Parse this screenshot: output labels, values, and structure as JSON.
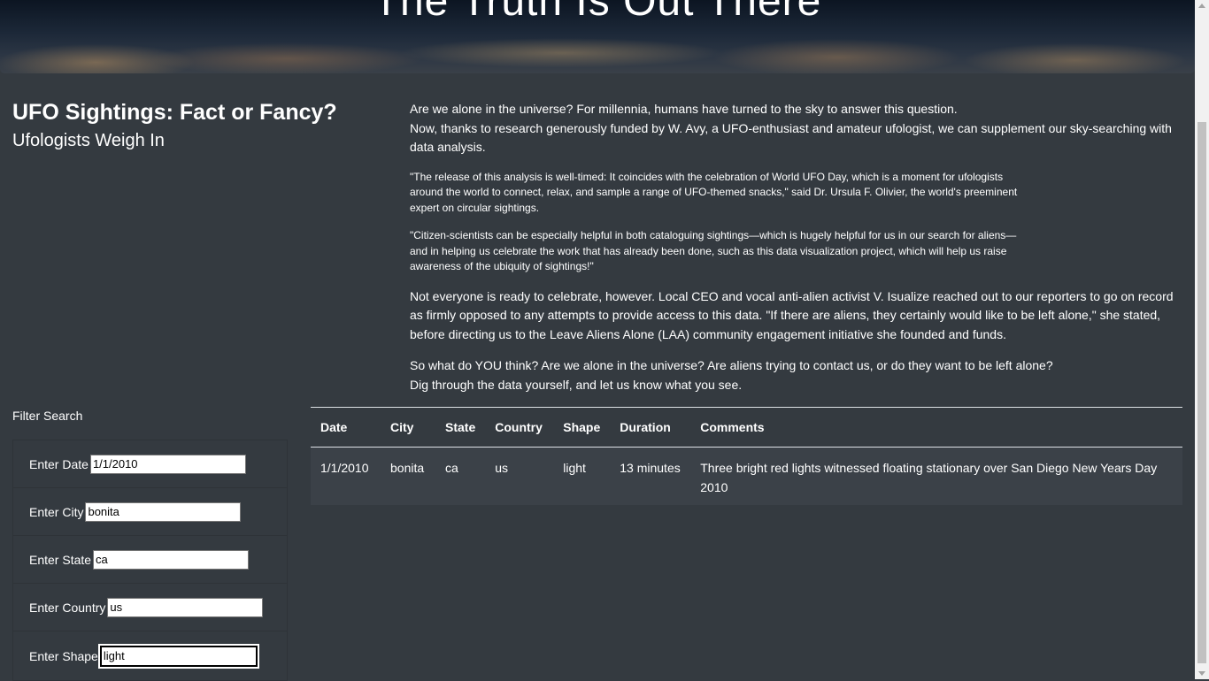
{
  "header": {
    "title": "The Truth Is Out There"
  },
  "intro": {
    "title": "UFO Sightings: Fact or Fancy?",
    "subtitle": "Ufologists Weigh In"
  },
  "article": {
    "p1_line1": "Are we alone in the universe? For millennia, humans have turned to the sky to answer this question.",
    "p1_line2": "Now, thanks to research generously funded by W. Avy, a UFO-enthusiast and amateur ufologist, we can supplement our sky-searching with data analysis.",
    "quote1": "\"The release of this analysis is well-timed: It coincides with the celebration of World UFO Day, which is a moment for ufologists around the world to connect, relax, and sample a range of UFO-themed snacks,\" said Dr. Ursula F. Olivier, the world's preeminent expert on circular sightings.",
    "quote2": "\"Citizen-scientists can be especially helpful in both cataloguing sightings—which is hugely helpful for us in our search for aliens—and in helping us celebrate the work that has already been done, such as this data visualization project, which will help us raise awareness of the ubiquity of sightings!\"",
    "p2": "Not everyone is ready to celebrate, however. Local CEO and vocal anti-alien activist V. Isualize reached out to our reporters to go on record as firmly opposed to any attempts to provide access to this data. \"If there are aliens, they certainly would like to be left alone,\" she stated, before directing us to the Leave Aliens Alone (LAA) community engagement initiative she founded and funds.",
    "p3_line1": "So what do YOU think? Are we alone in the universe? Are aliens trying to contact us, or do they want to be left alone?",
    "p3_line2": "Dig through the data yourself, and let us know what you see."
  },
  "filters": {
    "heading": "Filter Search",
    "items": [
      {
        "label": "Enter Date",
        "value": "1/1/2010"
      },
      {
        "label": "Enter City",
        "value": "bonita"
      },
      {
        "label": "Enter State",
        "value": "ca"
      },
      {
        "label": "Enter Country",
        "value": "us"
      },
      {
        "label": "Enter Shape",
        "value": "light"
      }
    ]
  },
  "table": {
    "headers": [
      "Date",
      "City",
      "State",
      "Country",
      "Shape",
      "Duration",
      "Comments"
    ],
    "rows": [
      [
        "1/1/2010",
        "bonita",
        "ca",
        "us",
        "light",
        "13 minutes",
        "Three bright red lights witnessed floating stationary over San Diego New Years Day 2010"
      ]
    ]
  }
}
